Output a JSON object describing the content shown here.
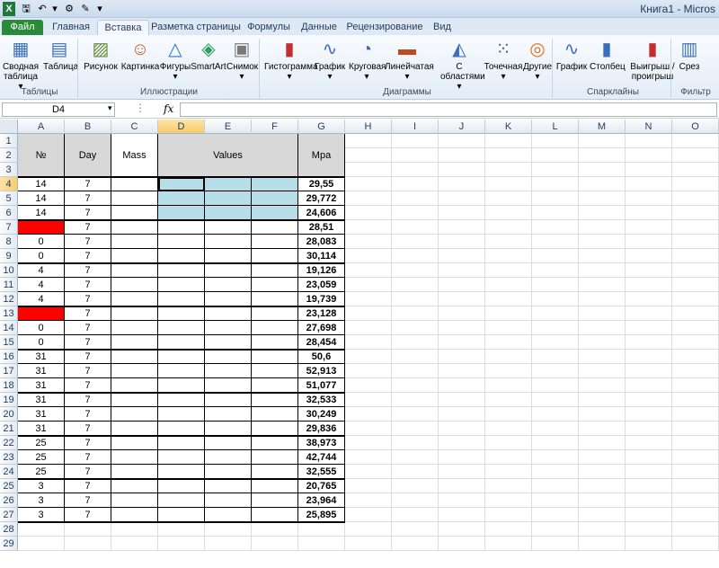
{
  "titlebar": {
    "title": "Книга1 - Micros",
    "qa_icons": [
      "excel-icon",
      "save-icon",
      "undo-icon",
      "chevron-down-icon",
      "dropdown-icon",
      "brush-icon",
      "customize-icon"
    ]
  },
  "tabs": [
    "Файл",
    "Главная",
    "Вставка",
    "Разметка страницы",
    "Формулы",
    "Данные",
    "Рецензирование",
    "Вид"
  ],
  "ribbon": {
    "buttons": [
      {
        "label": "Сводная\nтаблица ▾",
        "icon": "pivot-table-icon"
      },
      {
        "label": "Таблица",
        "icon": "table-icon"
      },
      {
        "label": "Рисунок",
        "icon": "picture-icon"
      },
      {
        "label": "Картинка",
        "icon": "clipart-icon"
      },
      {
        "label": "Фигуры\n▾",
        "icon": "shapes-icon"
      },
      {
        "label": "SmartArt",
        "icon": "smartart-icon"
      },
      {
        "label": "Снимок\n▾",
        "icon": "screenshot-icon"
      },
      {
        "label": "Гистограмма\n▾",
        "icon": "column-chart-icon"
      },
      {
        "label": "График\n▾",
        "icon": "line-chart-icon"
      },
      {
        "label": "Круговая\n▾",
        "icon": "pie-chart-icon"
      },
      {
        "label": "Линейчатая\n▾",
        "icon": "bar-chart-icon"
      },
      {
        "label": "С\nобластями ▾",
        "icon": "area-chart-icon"
      },
      {
        "label": "Точечная\n▾",
        "icon": "scatter-chart-icon"
      },
      {
        "label": "Другие\n▾",
        "icon": "other-charts-icon"
      },
      {
        "label": "График",
        "icon": "sparkline-line-icon"
      },
      {
        "label": "Столбец",
        "icon": "sparkline-column-icon"
      },
      {
        "label": "Выигрыш /\nпроигрыш",
        "icon": "sparkline-winloss-icon"
      },
      {
        "label": "Срез",
        "icon": "slicer-icon"
      }
    ],
    "groups": [
      "Таблицы",
      "Иллюстрации",
      "Диаграммы",
      "Спарклайны",
      "Фильтр"
    ]
  },
  "formula_bar": {
    "name_box": "D4",
    "fx": "fx",
    "value": ""
  },
  "columns": [
    "A",
    "B",
    "C",
    "D",
    "E",
    "F",
    "G",
    "H",
    "I",
    "J",
    "K",
    "L",
    "M",
    "N",
    "O"
  ],
  "rows": [
    "1",
    "2",
    "3",
    "4",
    "5",
    "6",
    "7",
    "8",
    "9",
    "10",
    "11",
    "12",
    "13",
    "14",
    "15",
    "16",
    "17",
    "18",
    "19",
    "20",
    "21",
    "22",
    "23",
    "24",
    "25",
    "26",
    "27",
    "28",
    "29"
  ],
  "header_row": {
    "a": "№",
    "b": "Day",
    "c": "Mass",
    "def": "Values",
    "g": "Mpa"
  },
  "table": [
    {
      "a": "14",
      "b": "7",
      "g": "29,55"
    },
    {
      "a": "14",
      "b": "7",
      "g": "29,772"
    },
    {
      "a": "14",
      "b": "7",
      "g": "24,606"
    },
    {
      "a": "",
      "b": "7",
      "g": "28,51",
      "red": true
    },
    {
      "a": "0",
      "b": "7",
      "g": "28,083"
    },
    {
      "a": "0",
      "b": "7",
      "g": "30,114"
    },
    {
      "a": "4",
      "b": "7",
      "g": "19,126"
    },
    {
      "a": "4",
      "b": "7",
      "g": "23,059"
    },
    {
      "a": "4",
      "b": "7",
      "g": "19,739"
    },
    {
      "a": "",
      "b": "7",
      "g": "23,128",
      "red": true
    },
    {
      "a": "0",
      "b": "7",
      "g": "27,698"
    },
    {
      "a": "0",
      "b": "7",
      "g": "28,454"
    },
    {
      "a": "31",
      "b": "7",
      "g": "50,6"
    },
    {
      "a": "31",
      "b": "7",
      "g": "52,913"
    },
    {
      "a": "31",
      "b": "7",
      "g": "51,077"
    },
    {
      "a": "31",
      "b": "7",
      "g": "32,533"
    },
    {
      "a": "31",
      "b": "7",
      "g": "30,249"
    },
    {
      "a": "31",
      "b": "7",
      "g": "29,836"
    },
    {
      "a": "25",
      "b": "7",
      "g": "38,973"
    },
    {
      "a": "25",
      "b": "7",
      "g": "42,744"
    },
    {
      "a": "25",
      "b": "7",
      "g": "32,555"
    },
    {
      "a": "3",
      "b": "7",
      "g": "20,765"
    },
    {
      "a": "3",
      "b": "7",
      "g": "23,964"
    },
    {
      "a": "3",
      "b": "7",
      "g": "25,895"
    }
  ],
  "colors": {
    "highlight_cyan": "#b7dde8",
    "red": "#ff0000",
    "header_gray": "#d8d8d8",
    "file_tab": "#2a8a3a"
  }
}
